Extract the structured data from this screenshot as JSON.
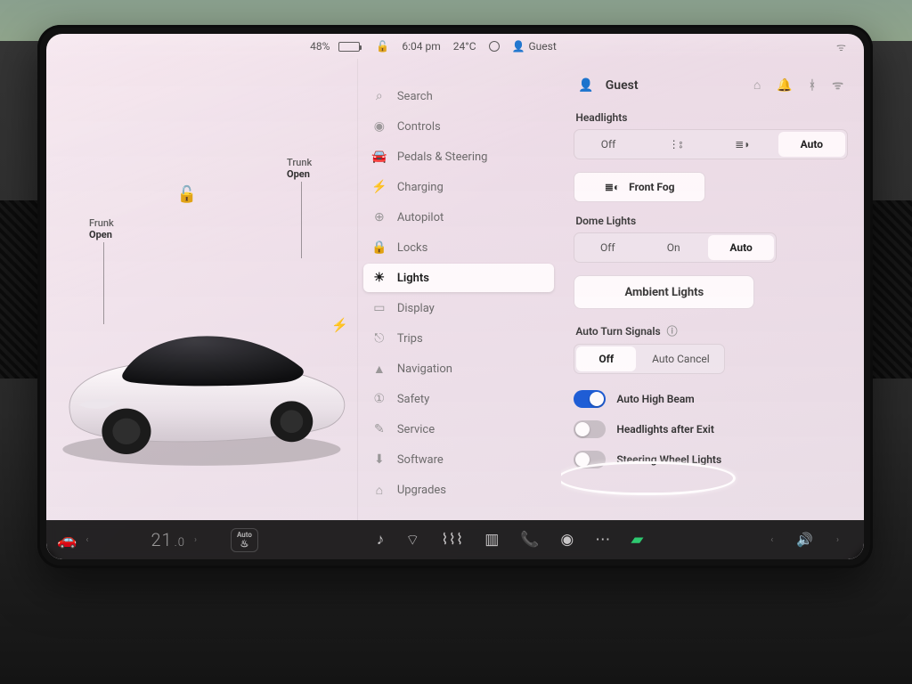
{
  "status_bar": {
    "battery_pct": "48%",
    "battery_fill_pct": 48,
    "time": "6:04 pm",
    "temperature": "24°C",
    "profile": "Guest"
  },
  "car_panel": {
    "frunk_label": "Frunk",
    "frunk_state": "Open",
    "trunk_label": "Trunk",
    "trunk_state": "Open"
  },
  "side_nav": {
    "items": [
      {
        "icon": "search-icon",
        "glyph": "⌕",
        "label": "Search"
      },
      {
        "icon": "controls-icon",
        "glyph": "◉",
        "label": "Controls"
      },
      {
        "icon": "pedals-icon",
        "glyph": "🚘",
        "label": "Pedals & Steering"
      },
      {
        "icon": "charging-icon",
        "glyph": "⚡",
        "label": "Charging"
      },
      {
        "icon": "autopilot-icon",
        "glyph": "⊕",
        "label": "Autopilot"
      },
      {
        "icon": "locks-icon",
        "glyph": "🔒",
        "label": "Locks"
      },
      {
        "icon": "lights-icon",
        "glyph": "☀",
        "label": "Lights",
        "selected": true
      },
      {
        "icon": "display-icon",
        "glyph": "▭",
        "label": "Display"
      },
      {
        "icon": "trips-icon",
        "glyph": "⎋",
        "label": "Trips"
      },
      {
        "icon": "navigation-icon",
        "glyph": "▲",
        "label": "Navigation"
      },
      {
        "icon": "safety-icon",
        "glyph": "①",
        "label": "Safety"
      },
      {
        "icon": "service-icon",
        "glyph": "✎",
        "label": "Service"
      },
      {
        "icon": "software-icon",
        "glyph": "⬇",
        "label": "Software"
      },
      {
        "icon": "upgrades-icon",
        "glyph": "⌂",
        "label": "Upgrades"
      }
    ]
  },
  "content": {
    "profile_name": "Guest",
    "headlights": {
      "label": "Headlights",
      "options": [
        "Off",
        "",
        "",
        ""
      ],
      "option_off": "Off",
      "option_auto": "Auto",
      "selected": "Auto"
    },
    "front_fog_label": "Front Fog",
    "dome": {
      "label": "Dome Lights",
      "options": {
        "off": "Off",
        "on": "On",
        "auto": "Auto"
      },
      "selected": "Auto"
    },
    "ambient_label": "Ambient Lights",
    "turn_signals": {
      "label": "Auto Turn Signals",
      "off": "Off",
      "auto_cancel": "Auto Cancel",
      "selected": "Off"
    },
    "toggles": {
      "auto_high_beam": {
        "label": "Auto High Beam",
        "on": true
      },
      "headlights_after_exit": {
        "label": "Headlights after Exit",
        "on": false
      },
      "steering_wheel_lights": {
        "label": "Steering Wheel Lights",
        "on": false
      }
    }
  },
  "dock": {
    "climate_temp_int": "21",
    "climate_temp_dec": ".0",
    "auto_label": "Auto",
    "heat_glyph": "♨"
  },
  "colors": {
    "accent_blue": "#1f5fd8",
    "call_green": "#2ecc71"
  }
}
